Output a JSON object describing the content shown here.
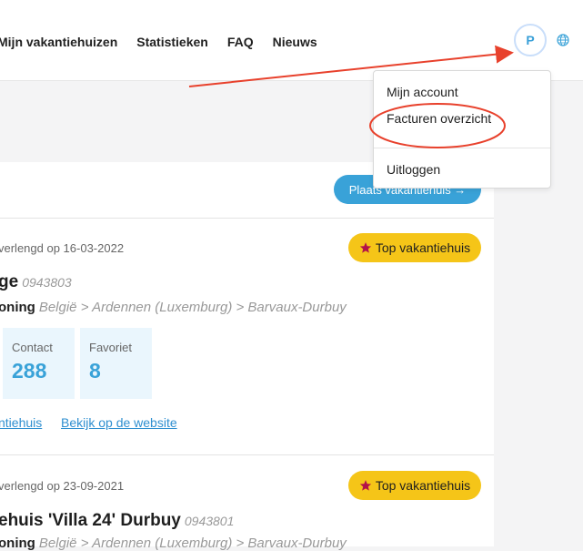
{
  "header": {
    "nav": [
      "Mijn vakantiehuizen",
      "Statistieken",
      "FAQ",
      "Nieuws"
    ],
    "avatar_initial": "P",
    "globe_icon": "globe-icon"
  },
  "dropdown": {
    "items": [
      "Mijn account",
      "Facturen overzicht",
      "Uitloggen"
    ]
  },
  "panel": {
    "cta_label": "Plaats vakantiehuis →"
  },
  "listings": [
    {
      "renewed": "verlengd op 16-03-2022",
      "badge": "Top vakantiehuis",
      "title": "ge",
      "code": "0943803",
      "type": "oning",
      "location": "België > Ardennen (Luxemburg) > Barvaux-Durbuy",
      "stats": [
        {
          "label": "Contact",
          "value": "288"
        },
        {
          "label": "Favoriet",
          "value": "8"
        }
      ],
      "links": [
        "ntiehuis",
        "Bekijk op de website"
      ]
    },
    {
      "renewed": "verlengd op 23-09-2021",
      "badge": "Top vakantiehuis",
      "title": "ehuis 'Villa 24' Durbuy",
      "code": "0943801",
      "type": "oning",
      "location": "België > Ardennen (Luxemburg) > Barvaux-Durbuy"
    }
  ],
  "colors": {
    "accent": "#39a2d8",
    "badge": "#f5c518",
    "star": "#b3124a",
    "annotation": "#e8412c"
  }
}
